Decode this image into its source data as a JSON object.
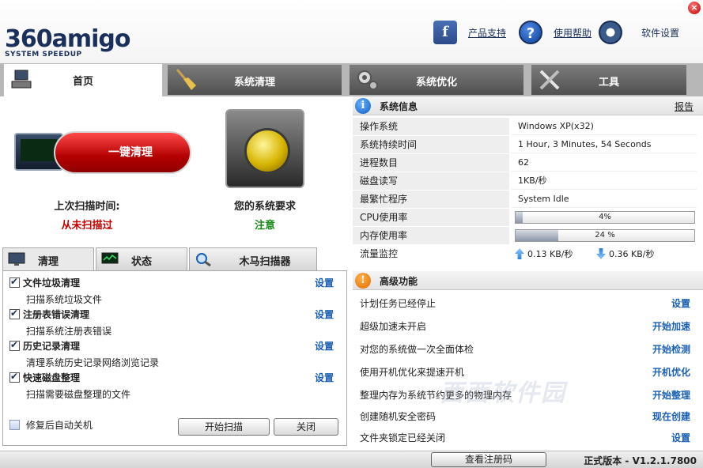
{
  "header": {
    "logo_text": "360amigo",
    "logo_sub": "SYSTEM SPEEDUP",
    "product_support": "产品支持",
    "help": "使用帮助",
    "settings": "软件设置",
    "close_glyph": "×"
  },
  "tabs": [
    {
      "label": "首页",
      "icon": "home-computer-icon"
    },
    {
      "label": "系统清理",
      "icon": "broom-icon"
    },
    {
      "label": "系统优化",
      "icon": "gears-icon"
    },
    {
      "label": "工具",
      "icon": "tools-icon"
    }
  ],
  "left": {
    "clean_button": "一键清理",
    "last_scan_label": "上次扫描时间:",
    "last_scan_value": "从未扫描过",
    "requirement_label": "您的系统要求",
    "requirement_value": "注意",
    "subtabs": [
      "清理",
      "状态",
      "木马扫描器"
    ],
    "items": [
      {
        "title": "文件垃圾清理",
        "desc": "扫描系统垃圾文件",
        "link": "设置",
        "checked": true
      },
      {
        "title": "注册表错误清理",
        "desc": "扫描系统注册表错误",
        "link": "设置",
        "checked": true
      },
      {
        "title": "历史记录清理",
        "desc": "清理系统历史记录网络浏览记录",
        "link": "设置",
        "checked": true
      },
      {
        "title": "快速磁盘整理",
        "desc": "扫描需要磁盘整理的文件",
        "link": "设置",
        "checked": true
      }
    ],
    "auto_shutdown": "修复后自动关机",
    "start_scan": "开始扫描",
    "close": "关闭"
  },
  "sysinfo": {
    "title": "系统信息",
    "report": "报告",
    "rows": [
      {
        "key": "操作系统",
        "value": "Windows XP(x32)"
      },
      {
        "key": "系统持续时间",
        "value": "1 Hour, 3 Minutes, 54 Seconds"
      },
      {
        "key": "进程数目",
        "value": "62"
      },
      {
        "key": "磁盘读写",
        "value": "1KB/秒"
      },
      {
        "key": "最繁忙程序",
        "value": "System Idle"
      }
    ],
    "cpu_label": "CPU使用率",
    "cpu_percent": 4,
    "cpu_text": "4%",
    "mem_label": "内存使用率",
    "mem_percent": 24,
    "mem_text": "24 %",
    "flow_label": "流量监控",
    "upload": "0.13 KB/秒",
    "download": "0.36 KB/秒"
  },
  "advanced": {
    "title": "高级功能",
    "rows": [
      {
        "text": "计划任务已经停止",
        "action": "设置"
      },
      {
        "text": "超级加速未开启",
        "action": "开始加速"
      },
      {
        "text": "对您的系统做一次全面体检",
        "action": "开始检测"
      },
      {
        "text": "使用开机优化来提速开机",
        "action": "开机优化"
      },
      {
        "text": "整理内存为系统节约更多的物理内存",
        "action": "开始整理"
      },
      {
        "text": "创建随机安全密码",
        "action": "现在创建"
      },
      {
        "text": "文件夹锁定已经关闭",
        "action": "设置"
      }
    ]
  },
  "footer": {
    "register": "查看注册码",
    "version": "正式版本 - V1.2.1.7800"
  },
  "watermark": "西西软件园"
}
